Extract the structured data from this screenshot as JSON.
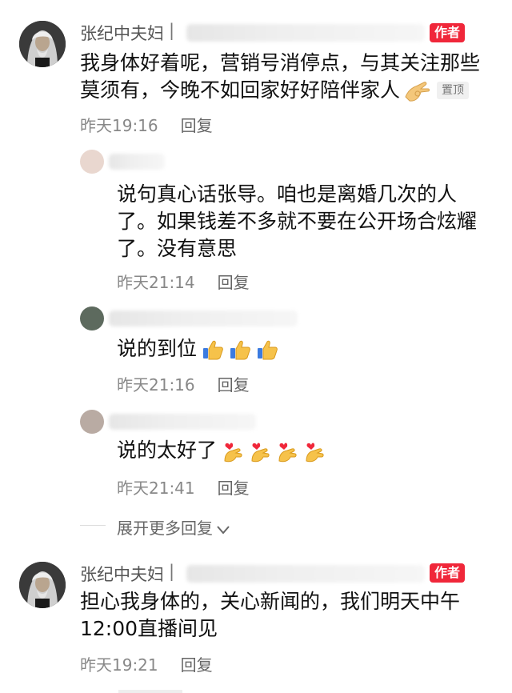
{
  "comments": [
    {
      "author": "张纪中夫妇",
      "separator": "|",
      "author_badge": "作者",
      "text_lines": [
        "我身体好着呢，营销号消停点，与其关注那些",
        "莫须有，今晚不如回家好好陪伴家人"
      ],
      "pin_label": "置顶",
      "time": "昨天19:16",
      "reply_label": "回复",
      "replies": [
        {
          "text_lines": [
            "说句真心话张导。咱也是离婚几次的人",
            "了。如果钱差不多就不要在公开场合炫耀",
            "了。没有意思"
          ],
          "time": "昨天21:14",
          "reply_label": "回复"
        },
        {
          "text_lines": [
            "说的到位"
          ],
          "emojis": [
            "thumbs-up-icon",
            "thumbs-up-icon",
            "thumbs-up-icon"
          ],
          "time": "昨天21:16",
          "reply_label": "回复"
        },
        {
          "text_lines": [
            "说的太好了"
          ],
          "emojis": [
            "finger-heart-icon",
            "finger-heart-icon",
            "finger-heart-icon",
            "finger-heart-icon"
          ],
          "time": "昨天21:41",
          "reply_label": "回复"
        }
      ],
      "expand_label": "展开更多回复"
    },
    {
      "author": "张纪中夫妇",
      "separator": "|",
      "author_badge": "作者",
      "text_lines": [
        "担心我身体的，关心新闻的，我们明天中午",
        "12:00直播间见"
      ],
      "time": "昨天19:21",
      "reply_label": "回复"
    }
  ],
  "colors": {
    "badge": "#f0273a",
    "meta": "#888888",
    "text": "#111111"
  }
}
